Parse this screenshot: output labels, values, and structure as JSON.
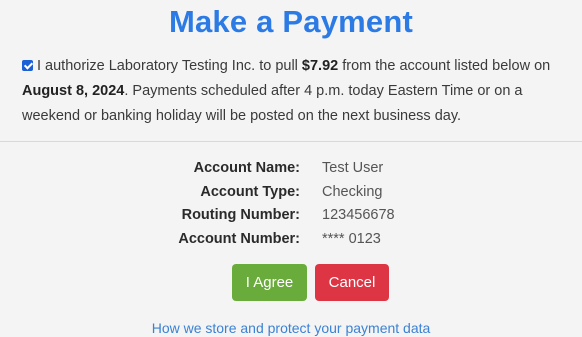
{
  "page": {
    "title": "Make a Payment"
  },
  "authorization": {
    "checked": true,
    "text_before_amount": "I authorize Laboratory Testing Inc. to pull ",
    "amount": "$7.92",
    "text_after_amount": " from the account listed below on",
    "date": "August 8, 2024",
    "text_after_date": ". Payments scheduled after 4 p.m. today Eastern Time or on a",
    "text_line3": "weekend or banking holiday will be posted on the next business day."
  },
  "account": {
    "rows": [
      {
        "label": "Account Name:",
        "value": "Test User"
      },
      {
        "label": "Account Type:",
        "value": "Checking"
      },
      {
        "label": "Routing Number:",
        "value": "123456678"
      },
      {
        "label": "Account Number:",
        "value": "**** 0123"
      }
    ]
  },
  "actions": {
    "agree_label": "I Agree",
    "cancel_label": "Cancel"
  },
  "footer": {
    "link_text": "How we store and protect your payment data"
  },
  "colors": {
    "title": "#2c7be5",
    "agree_button": "#6aac3b",
    "cancel_button": "#de3545",
    "link": "#3b82d4"
  }
}
